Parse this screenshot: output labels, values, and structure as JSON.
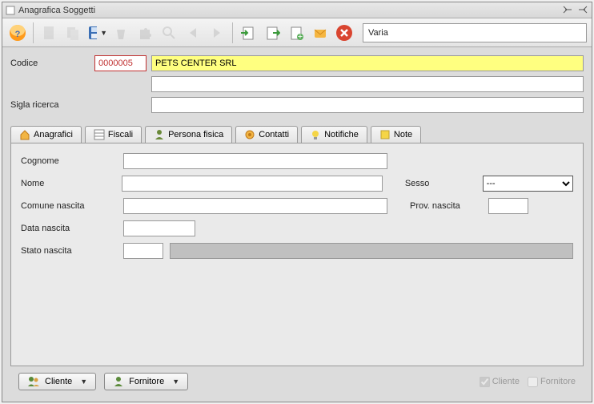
{
  "window": {
    "title": "Anagrafica Soggetti"
  },
  "toolbar": {
    "status": "Varia"
  },
  "header": {
    "codice_label": "Codice",
    "codice_value": "0000005",
    "name_value": "PETS CENTER SRL",
    "sigla_label": "Sigla ricerca",
    "sigla_value": ""
  },
  "tabs": [
    {
      "label": "Anagrafici",
      "active": false
    },
    {
      "label": "Fiscali",
      "active": false
    },
    {
      "label": "Persona fisica",
      "active": true
    },
    {
      "label": "Contatti",
      "active": false
    },
    {
      "label": "Notifiche",
      "active": false
    },
    {
      "label": "Note",
      "active": false
    }
  ],
  "form": {
    "cognome_label": "Cognome",
    "cognome_value": "",
    "nome_label": "Nome",
    "nome_value": "",
    "sesso_label": "Sesso",
    "sesso_value": "---",
    "comune_label": "Comune nascita",
    "comune_value": "",
    "prov_label": "Prov. nascita",
    "prov_value": "",
    "data_label": "Data nascita",
    "data_value": "",
    "stato_label": "Stato nascita",
    "stato_code": "",
    "stato_desc": ""
  },
  "footer": {
    "cliente_btn": "Cliente",
    "fornitore_btn": "Fornitore",
    "cliente_chk": "Cliente",
    "fornitore_chk": "Fornitore",
    "cliente_checked": true,
    "fornitore_checked": false
  }
}
